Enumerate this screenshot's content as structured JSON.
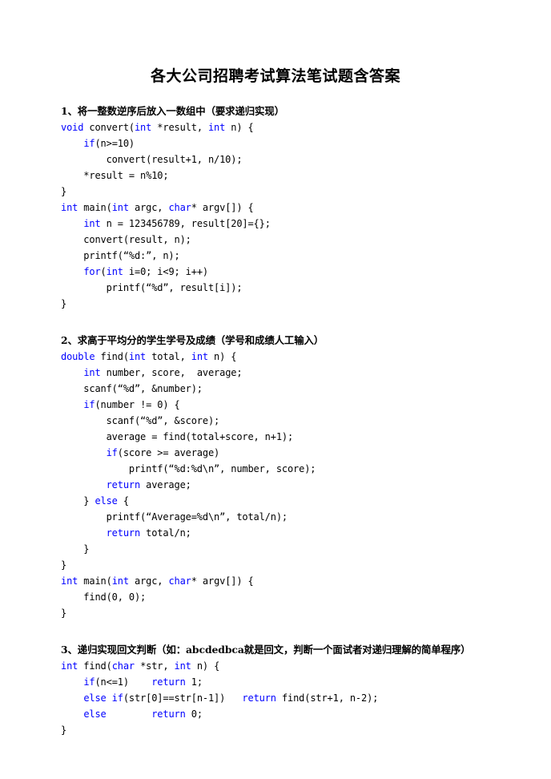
{
  "document": {
    "title": "各大公司招聘考试算法笔试题含答案"
  },
  "sections": [
    {
      "heading": "1、将一整数逆序后放入一数组中（要求递归实现）",
      "code": [
        [
          {
            "t": "void",
            "k": true
          },
          {
            "t": " convert(",
            "k": false
          },
          {
            "t": "int",
            "k": true
          },
          {
            "t": " *result, ",
            "k": false
          },
          {
            "t": "int",
            "k": true
          },
          {
            "t": " n) {",
            "k": false
          }
        ],
        [
          {
            "t": "    ",
            "k": false
          },
          {
            "t": "if",
            "k": true
          },
          {
            "t": "(n>=10)",
            "k": false
          }
        ],
        [
          {
            "t": "        convert(result+1, n/10);",
            "k": false
          }
        ],
        [
          {
            "t": "    *result = n%10;",
            "k": false
          }
        ],
        [
          {
            "t": "}",
            "k": false
          }
        ],
        [
          {
            "t": "int",
            "k": true
          },
          {
            "t": " main(",
            "k": false
          },
          {
            "t": "int",
            "k": true
          },
          {
            "t": " argc, ",
            "k": false
          },
          {
            "t": "char",
            "k": true
          },
          {
            "t": "* argv[]) {",
            "k": false
          }
        ],
        [
          {
            "t": "    ",
            "k": false
          },
          {
            "t": "int",
            "k": true
          },
          {
            "t": " n = 123456789, result[20]={};",
            "k": false
          }
        ],
        [
          {
            "t": "    convert(result, n);",
            "k": false
          }
        ],
        [
          {
            "t": "    printf(“%d:”, n);",
            "k": false
          }
        ],
        [
          {
            "t": "    ",
            "k": false
          },
          {
            "t": "for",
            "k": true
          },
          {
            "t": "(",
            "k": false
          },
          {
            "t": "int",
            "k": true
          },
          {
            "t": " i=0; i<9; i++)",
            "k": false
          }
        ],
        [
          {
            "t": "        printf(“%d”, result[i]);",
            "k": false
          }
        ],
        [
          {
            "t": "}",
            "k": false
          }
        ]
      ]
    },
    {
      "heading": "2、求高于平均分的学生学号及成绩（学号和成绩人工输入）",
      "code": [
        [
          {
            "t": "double",
            "k": true
          },
          {
            "t": " find(",
            "k": false
          },
          {
            "t": "int",
            "k": true
          },
          {
            "t": " total, ",
            "k": false
          },
          {
            "t": "int",
            "k": true
          },
          {
            "t": " n) {",
            "k": false
          }
        ],
        [
          {
            "t": "    ",
            "k": false
          },
          {
            "t": "int",
            "k": true
          },
          {
            "t": " number, score,  average;",
            "k": false
          }
        ],
        [
          {
            "t": "    scanf(“%d”, &number);",
            "k": false
          }
        ],
        [
          {
            "t": "    ",
            "k": false
          },
          {
            "t": "if",
            "k": true
          },
          {
            "t": "(number != 0) {",
            "k": false
          }
        ],
        [
          {
            "t": "        scanf(“%d”, &score);",
            "k": false
          }
        ],
        [
          {
            "t": "        average = find(total+score, n+1);",
            "k": false
          }
        ],
        [
          {
            "t": "        ",
            "k": false
          },
          {
            "t": "if",
            "k": true
          },
          {
            "t": "(score >= average)",
            "k": false
          }
        ],
        [
          {
            "t": "            printf(“%d:%d\\n”, number, score);",
            "k": false
          }
        ],
        [
          {
            "t": "        ",
            "k": false
          },
          {
            "t": "return",
            "k": true
          },
          {
            "t": " average;",
            "k": false
          }
        ],
        [
          {
            "t": "    } ",
            "k": false
          },
          {
            "t": "else",
            "k": true
          },
          {
            "t": " {",
            "k": false
          }
        ],
        [
          {
            "t": "        printf(“Average=%d\\n”, total/n);",
            "k": false
          }
        ],
        [
          {
            "t": "        ",
            "k": false
          },
          {
            "t": "return",
            "k": true
          },
          {
            "t": " total/n;",
            "k": false
          }
        ],
        [
          {
            "t": "    }",
            "k": false
          }
        ],
        [
          {
            "t": "}",
            "k": false
          }
        ],
        [
          {
            "t": "int",
            "k": true
          },
          {
            "t": " main(",
            "k": false
          },
          {
            "t": "int",
            "k": true
          },
          {
            "t": " argc, ",
            "k": false
          },
          {
            "t": "char",
            "k": true
          },
          {
            "t": "* argv[]) {",
            "k": false
          }
        ],
        [
          {
            "t": "    find(0, 0);",
            "k": false
          }
        ],
        [
          {
            "t": "}",
            "k": false
          }
        ]
      ]
    },
    {
      "heading": "3、递归实现回文判断（如：abcdedbca就是回文，判断一个面试者对递归理解的简单程序）",
      "code": [
        [
          {
            "t": "int",
            "k": true
          },
          {
            "t": " find(",
            "k": false
          },
          {
            "t": "char",
            "k": true
          },
          {
            "t": " *str, ",
            "k": false
          },
          {
            "t": "int",
            "k": true
          },
          {
            "t": " n) {",
            "k": false
          }
        ],
        [
          {
            "t": "    ",
            "k": false
          },
          {
            "t": "if",
            "k": true
          },
          {
            "t": "(n<=1)    ",
            "k": false
          },
          {
            "t": "return",
            "k": true
          },
          {
            "t": " 1;",
            "k": false
          }
        ],
        [
          {
            "t": "    ",
            "k": false
          },
          {
            "t": "else if",
            "k": true
          },
          {
            "t": "(str[0]==str[n-1])   ",
            "k": false
          },
          {
            "t": "return",
            "k": true
          },
          {
            "t": " find(str+1, n-2);",
            "k": false
          }
        ],
        [
          {
            "t": "    ",
            "k": false
          },
          {
            "t": "else",
            "k": true
          },
          {
            "t": "        ",
            "k": false
          },
          {
            "t": "return",
            "k": true
          },
          {
            "t": " 0;",
            "k": false
          }
        ],
        [
          {
            "t": "}",
            "k": false
          }
        ]
      ]
    }
  ],
  "colors": {
    "keyword": "#0000ff",
    "text": "#000000",
    "background": "#ffffff"
  }
}
